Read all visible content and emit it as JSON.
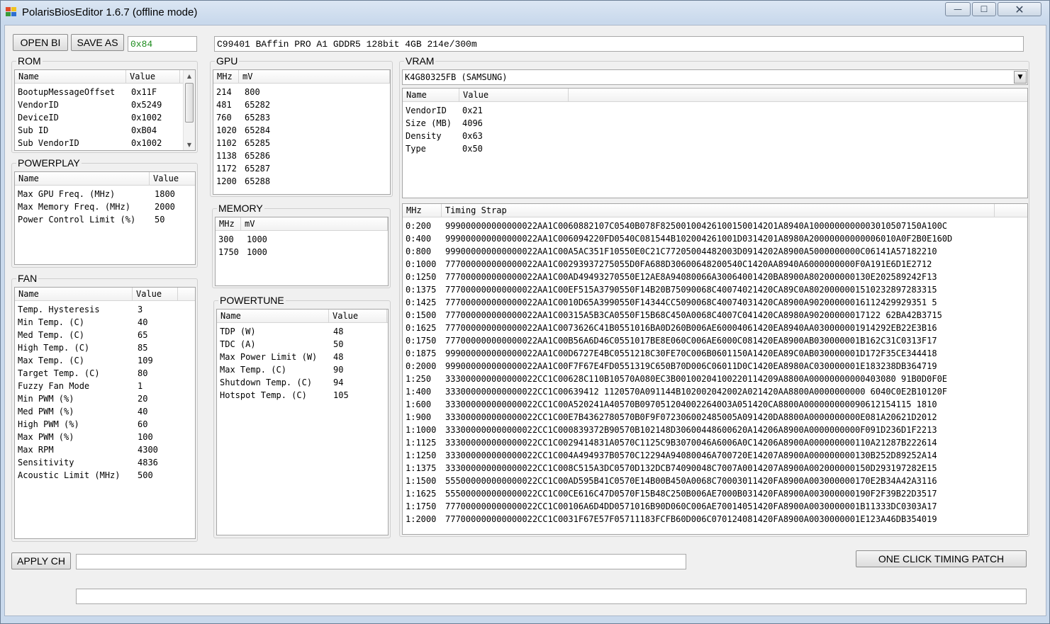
{
  "window": {
    "title": "PolarisBiosEditor 1.6.7 (offline mode)",
    "minimize_glyph": "—",
    "maximize_glyph": "☐",
    "close_glyph": "✕",
    "icon": "app-icon"
  },
  "toolbar": {
    "open_label": "OPEN BI",
    "save_label": "SAVE AS",
    "checksum_value": "0x84",
    "bios_info": "C99401 BAffin PRO A1 GDDR5 128bit 4GB 214e/300m"
  },
  "rom": {
    "label": "ROM",
    "headers": [
      "Name",
      "Value"
    ],
    "rows": [
      [
        "BootupMessageOffset",
        "0x11F"
      ],
      [
        "VendorID",
        "0x5249"
      ],
      [
        "DeviceID",
        "0x1002"
      ],
      [
        "Sub ID",
        "0xB04"
      ],
      [
        "Sub VendorID",
        "0x1002"
      ]
    ]
  },
  "powerplay": {
    "label": "POWERPLAY",
    "headers": [
      "Name",
      "Value"
    ],
    "rows": [
      [
        "Max GPU Freq. (MHz)",
        "1800"
      ],
      [
        "Max Memory Freq. (MHz)",
        "2000"
      ],
      [
        "Power Control Limit (%)",
        "50"
      ]
    ]
  },
  "fan": {
    "label": "FAN",
    "headers": [
      "Name",
      "Value"
    ],
    "rows": [
      [
        "Temp. Hysteresis",
        "3"
      ],
      [
        "Min Temp. (C)",
        "40"
      ],
      [
        "Med Temp. (C)",
        "65"
      ],
      [
        "High Temp. (C)",
        "85"
      ],
      [
        "Max Temp. (C)",
        "109"
      ],
      [
        "Target Temp. (C)",
        "80"
      ],
      [
        "Fuzzy Fan Mode",
        "1"
      ],
      [
        "Min PWM (%)",
        "20"
      ],
      [
        "Med PWM (%)",
        "40"
      ],
      [
        "High PWM (%)",
        "60"
      ],
      [
        "Max PWM (%)",
        "100"
      ],
      [
        "Max RPM",
        "4300"
      ],
      [
        "Sensitivity",
        "4836"
      ],
      [
        "Acoustic Limit (MHz)",
        "500"
      ]
    ]
  },
  "gpu": {
    "label": "GPU",
    "headers": [
      "MHz",
      "mV"
    ],
    "rows": [
      [
        "214",
        "800"
      ],
      [
        "481",
        "65282"
      ],
      [
        "760",
        "65283"
      ],
      [
        "1020",
        "65284"
      ],
      [
        "1102",
        "65285"
      ],
      [
        "1138",
        "65286"
      ],
      [
        "1172",
        "65287"
      ],
      [
        "1200",
        "65288"
      ]
    ]
  },
  "memory": {
    "label": "MEMORY",
    "headers": [
      "MHz",
      "mV"
    ],
    "rows": [
      [
        "300",
        "1000"
      ],
      [
        "1750",
        "1000"
      ]
    ]
  },
  "powertune": {
    "label": "POWERTUNE",
    "headers": [
      "Name",
      "Value"
    ],
    "rows": [
      [
        "TDP (W)",
        "48"
      ],
      [
        "TDC (A)",
        "50"
      ],
      [
        "Max Power Limit (W)",
        "48"
      ],
      [
        "Max Temp. (C)",
        "90"
      ],
      [
        "Shutdown Temp. (C)",
        "94"
      ],
      [
        "Hotspot Temp. (C)",
        "105"
      ]
    ]
  },
  "vram": {
    "label": "VRAM",
    "selected": "K4G80325FB (SAMSUNG)",
    "headers": [
      "Name",
      "Value"
    ],
    "rows": [
      [
        "VendorID",
        "0x21"
      ],
      [
        "Size (MB)",
        "4096"
      ],
      [
        "Density",
        "0x63"
      ],
      [
        "Type",
        "0x50"
      ]
    ]
  },
  "timings": {
    "headers": [
      "MHz",
      "Timing Strap"
    ],
    "rows": [
      [
        "0:200",
        "999000000000000022AA1C0060882107C0540B078F825001004261001500142O1A8940A1000000000003010507150A100C"
      ],
      [
        "0:400",
        "999000000000000022AA1C006094220FD0540C081544B102004261001D0314201A8980A20000000000006010A0F2B0E160D"
      ],
      [
        "0:800",
        "999000000000000022AA1C00A5AC351F10550E0C21C77205004482003D0914202A8900A5000000000C06141A57182210"
      ],
      [
        "0:1000",
        "777000000000000022AA1C00293937275055D0FA688D30600648200540C1420AA8940A6000000000F0A191E6D1E2712"
      ],
      [
        "0:1250",
        "777000000000000022AA1C00AD49493270550E12AE8A94080066A30064001420BA8900A802000000130E202589242F13"
      ],
      [
        "0:1375",
        "777000000000000022AA1C00EF515A3790550F14B20B75090068C40074021420CA89C0A8020000001510232897283315"
      ],
      [
        "0:1425",
        "777000000000000022AA1C0010D65A3990550F14344CC5090068C40074031420CA8900A90200000016112429929351 5"
      ],
      [
        "0:1500",
        "777000000000000022AA1C00315A5B3CA0550F15B68C450A0068C4007C041420CA8980A90200000017122 62BA42B3715"
      ],
      [
        "0:1625",
        "777000000000000022AA1C0073626C41B0551016BA0D260B006AE60004061420EA8940AA030000001914292EB22E3B16"
      ],
      [
        "0:1750",
        "777000000000000022AA1C00B56A6D46C0551017BE8E060C006AE6000C081420EA8900AB030000001B162C31C0313F17"
      ],
      [
        "0:1875",
        "999000000000000022AA1C00D6727E4BC0551218C30FE70C006B0601150A1420EA89C0AB030000001D172F35CE344418"
      ],
      [
        "0:2000",
        "999000000000000022AA1C00F7F67E4FD0551319C650B70D006C06011D0C1420EA8980AC030000001E183238DB364719"
      ],
      [
        "1:250",
        "333000000000000022CC1C00628C110B10570A080EC3B00100204100220114209A8800A00000000000403080 91B0D0F0E"
      ],
      [
        "1:400",
        "333000000000000022CC1C00639412 1120570A091144B102002042002A021420AA8800A0000000000 6040C0E2B10120F"
      ],
      [
        "1:600",
        "333000000000000022CC1C00A520241A40570B0970512040022640O3A051420CA8800A000000000090612154115 1810"
      ],
      [
        "1:900",
        "333000000000000022CC1C00E7B4362780570B0F9F072306002485005A091420DA8800A0000000000E081A20621D2012"
      ],
      [
        "1:1000",
        "333000000000000022CC1C000839372B90570B102148D30600448600620A14206A8900A0000000000F091D236D1F2213"
      ],
      [
        "1:1125",
        "333000000000000022CC1C0029414831A0570C1125C9B3070046A6006A0C14206A8900A000000000110A21287B222614"
      ],
      [
        "1:1250",
        "333000000000000022CC1C004A494937B0570C12294A94080046A700720E14207A8900A000000000130B252D89252A14"
      ],
      [
        "1:1375",
        "333000000000000022CC1C008C515A3DC0570D132DCB74090048C7007A0014207A8900A002000000150D293197282E15"
      ],
      [
        "1:1500",
        "555000000000000022CC1C00AD595B41C0570E14B00B450A0068C70003011420FA8900A003000000170E2B34A42A3116"
      ],
      [
        "1:1625",
        "555000000000000022CC1C00CE616C47D0570F15B48C250B006AE7000B031420FA8900A003000000190F2F39B22D3517"
      ],
      [
        "1:1750",
        "777000000000000022CC1C00106A6D4DD0571016B90D060C006AE70014051420FA8900A0030000001B11333DC0303A17"
      ],
      [
        "1:2000",
        "777000000000000022CC1C0031F67E57F05711183FCFB60D006C070124081420FA8900A0030000001E123A46DB354019"
      ]
    ]
  },
  "bottom": {
    "apply_label": "APPLY CH",
    "apply_status": "",
    "timing_patch_label": "ONE CLICK TIMING PATCH",
    "log": ""
  },
  "colors": {
    "checksum_text": "#1a8a1a",
    "title_bg": "#c9d9ec"
  }
}
